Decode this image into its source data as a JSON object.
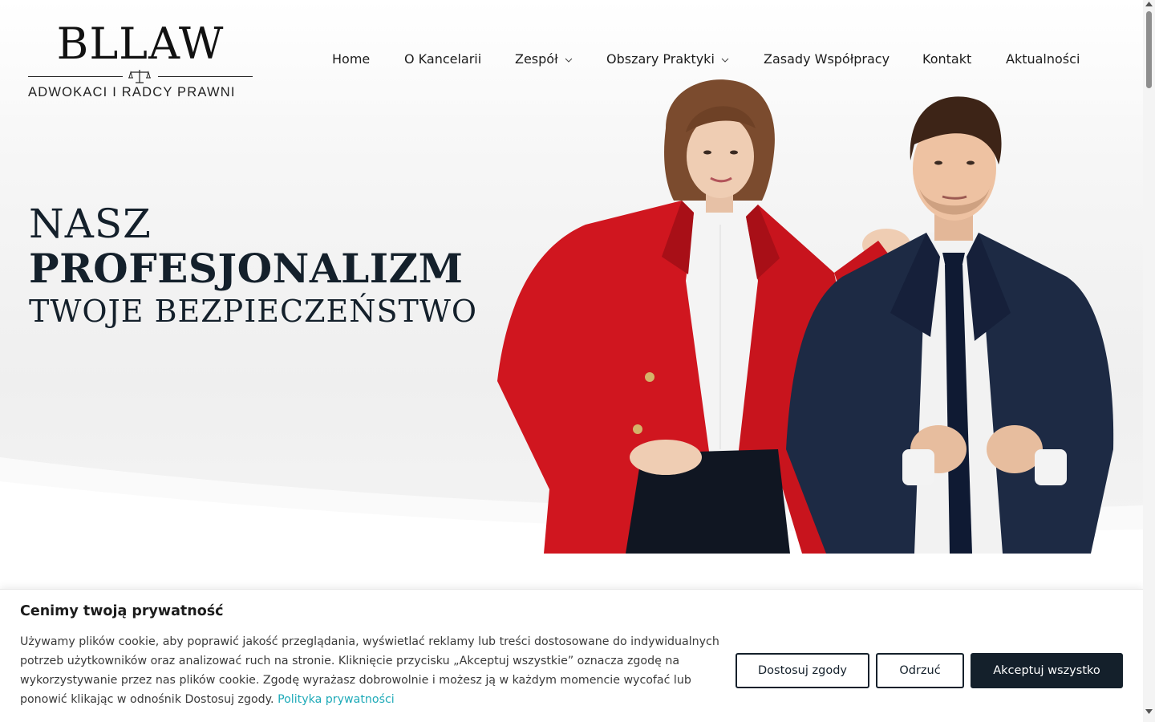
{
  "brand": {
    "name": "BLLAW",
    "tagline": "ADWOKACI I RADCY PRAWNI"
  },
  "nav": {
    "items": [
      {
        "label": "Home",
        "dropdown": false
      },
      {
        "label": "O Kancelarii",
        "dropdown": false
      },
      {
        "label": "Zespół",
        "dropdown": true
      },
      {
        "label": "Obszary Praktyki",
        "dropdown": true
      },
      {
        "label": "Zasady Współpracy",
        "dropdown": false
      },
      {
        "label": "Kontakt",
        "dropdown": false
      },
      {
        "label": "Aktualności",
        "dropdown": false
      }
    ]
  },
  "hero": {
    "line1": "NASZ",
    "line2": "PROFESJONALIZM",
    "line3": "TWOJE BEZPIECZEŃSTWO"
  },
  "cookie": {
    "title": "Cenimy twoją prywatność",
    "text": "Używamy plików cookie, aby poprawić jakość przeglądania, wyświetlać reklamy lub treści dostosowane do indywidualnych potrzeb użytkowników oraz analizować ruch na stronie. Kliknięcie przycisku „Akceptuj wszystkie” oznacza zgodę na wykorzystywanie przez nas plików cookie. Zgodę wyrażasz dobrowolnie i możesz ją w każdym momencie wycofać lub ponowić klikając w odnośnik Dostosuj zgody.",
    "link": "Polityka prywatności",
    "buttons": {
      "customize": "Dostosuj zgody",
      "reject": "Odrzuć",
      "accept": "Akceptuj wszystko"
    }
  },
  "colors": {
    "navy": "#14202b",
    "link": "#1eaab8",
    "jacket_red": "#d0161f",
    "suit_navy": "#1d2a44"
  }
}
